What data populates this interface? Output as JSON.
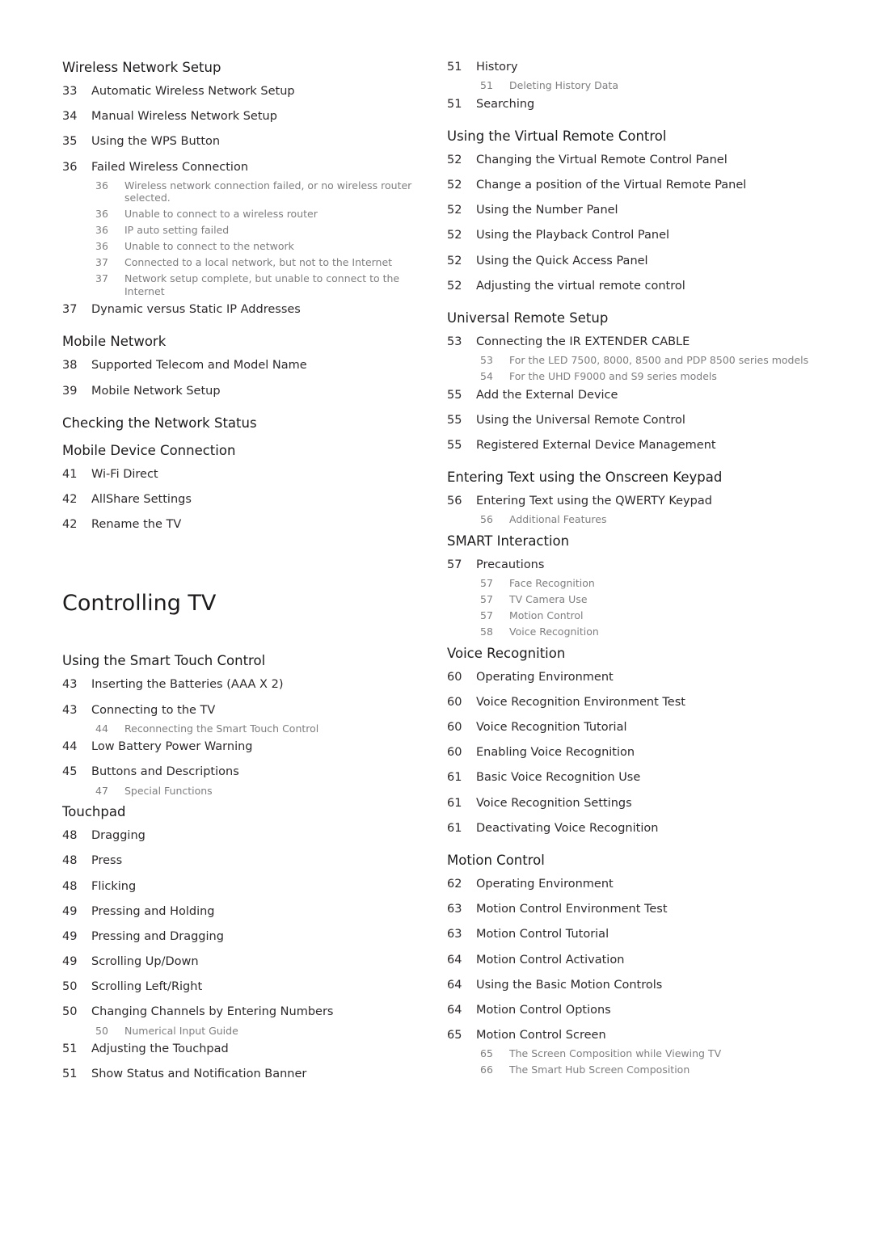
{
  "left_column": {
    "sections_before_chapter": [
      {
        "title": "Wireless Network Setup",
        "entries": [
          {
            "page": "33",
            "text": "Automatic Wireless Network Setup"
          },
          {
            "page": "34",
            "text": "Manual Wireless Network Setup"
          },
          {
            "page": "35",
            "text": "Using the WPS Button"
          },
          {
            "page": "36",
            "text": "Failed Wireless Connection",
            "subs": [
              {
                "page": "36",
                "text": "Wireless network connection failed, or no wireless router selected."
              },
              {
                "page": "36",
                "text": "Unable to connect to a wireless router"
              },
              {
                "page": "36",
                "text": "IP auto setting failed"
              },
              {
                "page": "36",
                "text": "Unable to connect to the network"
              },
              {
                "page": "37",
                "text": "Connected to a local network, but not to the Internet"
              },
              {
                "page": "37",
                "text": "Network setup complete, but unable to connect to the Internet"
              }
            ]
          },
          {
            "page": "37",
            "text": "Dynamic versus Static IP Addresses"
          }
        ]
      },
      {
        "title": "Mobile Network",
        "entries": [
          {
            "page": "38",
            "text": "Supported Telecom and Model Name"
          },
          {
            "page": "39",
            "text": "Mobile Network Setup"
          }
        ]
      },
      {
        "title": "Checking the Network Status",
        "entries": []
      },
      {
        "title": "Mobile Device Connection",
        "entries": [
          {
            "page": "41",
            "text": "Wi-Fi Direct"
          },
          {
            "page": "42",
            "text": "AllShare Settings"
          },
          {
            "page": "42",
            "text": "Rename the TV"
          }
        ]
      }
    ],
    "chapter_title": "Controlling TV",
    "sections_after_chapter": [
      {
        "title": "Using the Smart Touch Control",
        "entries": [
          {
            "page": "43",
            "text": "Inserting the Batteries (AAA X 2)"
          },
          {
            "page": "43",
            "text": "Connecting to the TV",
            "subs": [
              {
                "page": "44",
                "text": "Reconnecting the Smart Touch Control"
              }
            ]
          },
          {
            "page": "44",
            "text": "Low Battery Power Warning"
          },
          {
            "page": "45",
            "text": "Buttons and Descriptions",
            "subs": [
              {
                "page": "47",
                "text": "Special Functions"
              }
            ]
          }
        ]
      },
      {
        "title": "Touchpad",
        "entries": [
          {
            "page": "48",
            "text": "Dragging"
          },
          {
            "page": "48",
            "text": "Press"
          },
          {
            "page": "48",
            "text": "Flicking"
          },
          {
            "page": "49",
            "text": "Pressing and Holding"
          },
          {
            "page": "49",
            "text": "Pressing and Dragging"
          },
          {
            "page": "49",
            "text": "Scrolling Up/Down"
          },
          {
            "page": "50",
            "text": "Scrolling Left/Right"
          },
          {
            "page": "50",
            "text": "Changing Channels by Entering Numbers",
            "subs": [
              {
                "page": "50",
                "text": "Numerical Input Guide"
              }
            ]
          },
          {
            "page": "51",
            "text": "Adjusting the Touchpad"
          },
          {
            "page": "51",
            "text": "Show Status and Notification Banner"
          }
        ]
      }
    ]
  },
  "right_column": {
    "sections": [
      {
        "title": "",
        "entries": [
          {
            "page": "51",
            "text": "History",
            "subs": [
              {
                "page": "51",
                "text": "Deleting History Data"
              }
            ]
          },
          {
            "page": "51",
            "text": "Searching"
          }
        ]
      },
      {
        "title": "Using the Virtual Remote Control",
        "entries": [
          {
            "page": "52",
            "text": "Changing the Virtual Remote Control Panel"
          },
          {
            "page": "52",
            "text": "Change a position of the Virtual Remote Panel"
          },
          {
            "page": "52",
            "text": "Using the Number Panel"
          },
          {
            "page": "52",
            "text": "Using the Playback Control Panel"
          },
          {
            "page": "52",
            "text": "Using the Quick Access Panel"
          },
          {
            "page": "52",
            "text": "Adjusting the virtual remote control"
          }
        ]
      },
      {
        "title": "Universal Remote Setup",
        "entries": [
          {
            "page": "53",
            "text": "Connecting the IR EXTENDER CABLE",
            "subs": [
              {
                "page": "53",
                "text": "For the LED 7500, 8000, 8500 and PDP 8500 series models"
              },
              {
                "page": "54",
                "text": "For the UHD F9000 and S9 series models"
              }
            ]
          },
          {
            "page": "55",
            "text": "Add the External Device"
          },
          {
            "page": "55",
            "text": "Using the Universal Remote Control"
          },
          {
            "page": "55",
            "text": "Registered External Device Management"
          }
        ]
      },
      {
        "title": "Entering Text using the Onscreen Keypad",
        "entries": [
          {
            "page": "56",
            "text": "Entering Text using the QWERTY Keypad",
            "subs": [
              {
                "page": "56",
                "text": "Additional Features"
              }
            ]
          }
        ]
      },
      {
        "title": "SMART Interaction",
        "entries": [
          {
            "page": "57",
            "text": "Precautions",
            "subs": [
              {
                "page": "57",
                "text": "Face Recognition"
              },
              {
                "page": "57",
                "text": "TV Camera Use"
              },
              {
                "page": "57",
                "text": "Motion Control"
              },
              {
                "page": "58",
                "text": "Voice Recognition"
              }
            ]
          }
        ]
      },
      {
        "title": "Voice Recognition",
        "entries": [
          {
            "page": "60",
            "text": "Operating Environment"
          },
          {
            "page": "60",
            "text": "Voice Recognition Environment Test"
          },
          {
            "page": "60",
            "text": "Voice Recognition Tutorial"
          },
          {
            "page": "60",
            "text": "Enabling Voice Recognition"
          },
          {
            "page": "61",
            "text": "Basic Voice Recognition Use"
          },
          {
            "page": "61",
            "text": "Voice Recognition Settings"
          },
          {
            "page": "61",
            "text": "Deactivating Voice Recognition"
          }
        ]
      },
      {
        "title": "Motion Control",
        "entries": [
          {
            "page": "62",
            "text": "Operating Environment"
          },
          {
            "page": "63",
            "text": "Motion Control Environment Test"
          },
          {
            "page": "63",
            "text": "Motion Control Tutorial"
          },
          {
            "page": "64",
            "text": "Motion Control Activation"
          },
          {
            "page": "64",
            "text": "Using the Basic Motion Controls"
          },
          {
            "page": "64",
            "text": "Motion Control Options"
          },
          {
            "page": "65",
            "text": "Motion Control Screen",
            "subs": [
              {
                "page": "65",
                "text": "The Screen Composition while Viewing TV"
              },
              {
                "page": "66",
                "text": "The Smart Hub Screen Composition"
              }
            ]
          }
        ]
      }
    ]
  }
}
